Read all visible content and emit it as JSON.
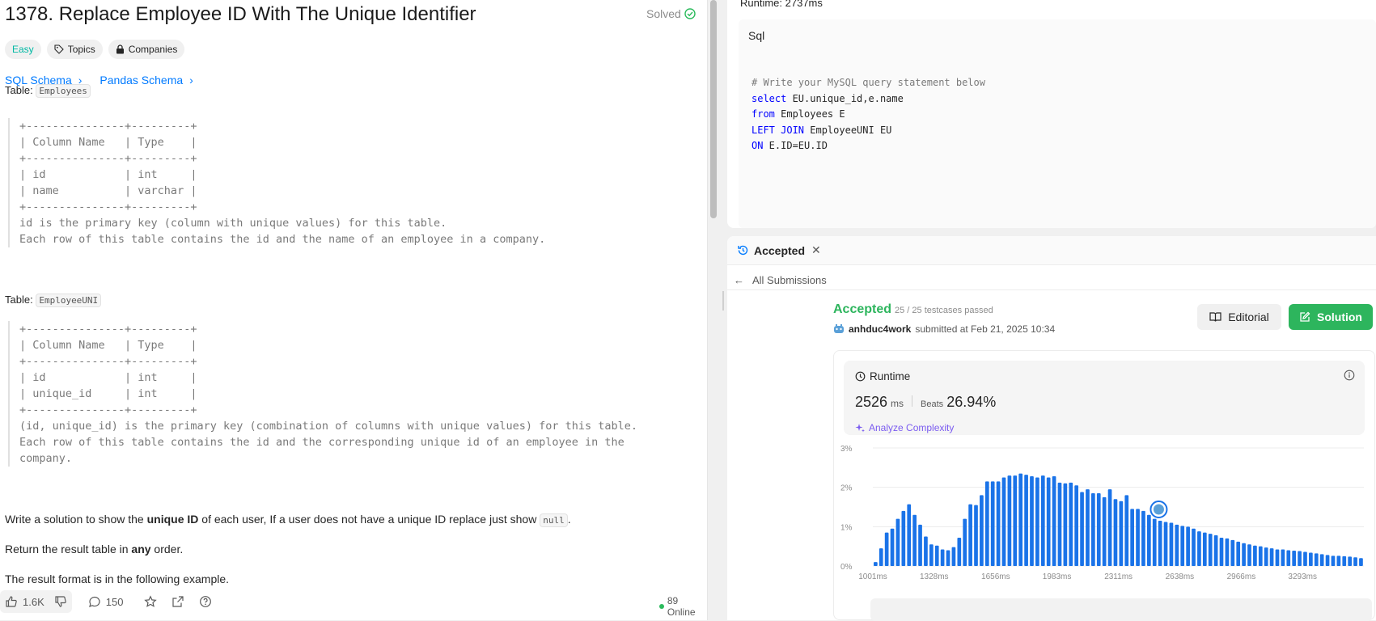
{
  "problem": {
    "title": "1378. Replace Employee ID With The Unique Identifier",
    "status": "Solved",
    "tags": [
      "Easy",
      "Topics",
      "Companies"
    ],
    "schemas": [
      "SQL Schema",
      "Pandas Schema"
    ],
    "table1_prefix": "Table:",
    "table1_name": "Employees",
    "table1_text": "+---------------+---------+\n| Column Name   | Type    |\n+---------------+---------+\n| id            | int     |\n| name          | varchar |\n+---------------+---------+\nid is the primary key (column with unique values) for this table.\nEach row of this table contains the id and the name of an employee in a company.",
    "table2_prefix": "Table:",
    "table2_name": "EmployeeUNI",
    "table2_text": "+---------------+---------+\n| Column Name   | Type    |\n+---------------+---------+\n| id            | int     |\n| unique_id     | int     |\n+---------------+---------+\n(id, unique_id) is the primary key (combination of columns with unique values) for this table.\nEach row of this table contains the id and the corresponding unique id of an employee in the\ncompany.",
    "para1_pre": "Write a solution to show the ",
    "para1_bold": "unique ID",
    "para1_mid": " of each user, If a user does not have a unique ID replace just show ",
    "para1_code": "null",
    "para1_end": ".",
    "para2_pre": "Return the result table in ",
    "para2_bold": "any",
    "para2_end": " order.",
    "para3": "The result format is in the following example."
  },
  "footer": {
    "likes": "1.6K",
    "comments": "150",
    "online": "89 Online"
  },
  "editor": {
    "runtime_top": "Runtime: 2737ms",
    "language": "Sql",
    "code_lines": [
      [
        {
          "t": "# Write your MySQL query statement below",
          "c": "cm"
        }
      ],
      [
        {
          "t": "select",
          "c": "kw"
        },
        {
          "t": " EU.unique_id,e.name",
          "c": ""
        }
      ],
      [
        {
          "t": "from",
          "c": "kw"
        },
        {
          "t": " Employees E",
          "c": ""
        }
      ],
      [
        {
          "t": "LEFT JOIN",
          "c": "kw"
        },
        {
          "t": " EmployeeUNI EU",
          "c": ""
        }
      ],
      [
        {
          "t": "ON",
          "c": "kw"
        },
        {
          "t": " E.ID=EU.ID",
          "c": ""
        }
      ]
    ]
  },
  "result": {
    "tab_label": "Accepted",
    "all_submissions": "All Submissions",
    "status": "Accepted",
    "testcases": "25 / 25 testcases passed",
    "username": "anhduc4work",
    "submitted_at": "submitted at Feb 21, 2025 10:34",
    "editorial_label": "Editorial",
    "solution_label": "Solution",
    "runtime_label": "Runtime",
    "runtime_value": "2526",
    "runtime_unit": "ms",
    "beats_label": "Beats",
    "beats_value": "26.94%",
    "analyze_label": "Analyze Complexity"
  },
  "colors": {
    "accent": "#007aff",
    "accepted": "#2db55d",
    "bar": "#1a73e8",
    "easy": "#00b8a3"
  },
  "chart_data": {
    "type": "bar",
    "ylabel_ticks": [
      "0%",
      "1%",
      "2%",
      "3%"
    ],
    "ylim": [
      0,
      3
    ],
    "x_tick_labels": [
      "1001ms",
      "1328ms",
      "1656ms",
      "1983ms",
      "2311ms",
      "2638ms",
      "2966ms",
      "3293ms"
    ],
    "xlim": [
      1001,
      3620
    ],
    "bin_width": 25,
    "values": [
      0.1,
      0.45,
      0.85,
      0.95,
      1.2,
      1.4,
      1.57,
      1.3,
      1.05,
      0.75,
      0.55,
      0.52,
      0.42,
      0.4,
      0.48,
      0.72,
      1.2,
      1.57,
      1.55,
      1.8,
      2.15,
      2.15,
      2.15,
      2.25,
      2.3,
      2.3,
      2.35,
      2.32,
      2.28,
      2.25,
      2.3,
      2.25,
      2.28,
      2.12,
      2.1,
      2.12,
      2.05,
      1.88,
      1.95,
      1.85,
      1.85,
      1.75,
      1.95,
      1.7,
      1.65,
      1.8,
      1.45,
      1.45,
      1.4,
      1.3,
      1.2,
      1.15,
      1.12,
      1.1,
      1.05,
      1.02,
      1.0,
      0.95,
      0.88,
      0.85,
      0.82,
      0.78,
      0.72,
      0.7,
      0.66,
      0.62,
      0.58,
      0.55,
      0.52,
      0.5,
      0.47,
      0.45,
      0.42,
      0.42,
      0.4,
      0.39,
      0.38,
      0.36,
      0.34,
      0.32,
      0.3,
      0.28,
      0.26,
      0.26,
      0.25,
      0.24,
      0.22,
      0.2
    ],
    "highlight_value_ms": 2526,
    "grid": true
  }
}
